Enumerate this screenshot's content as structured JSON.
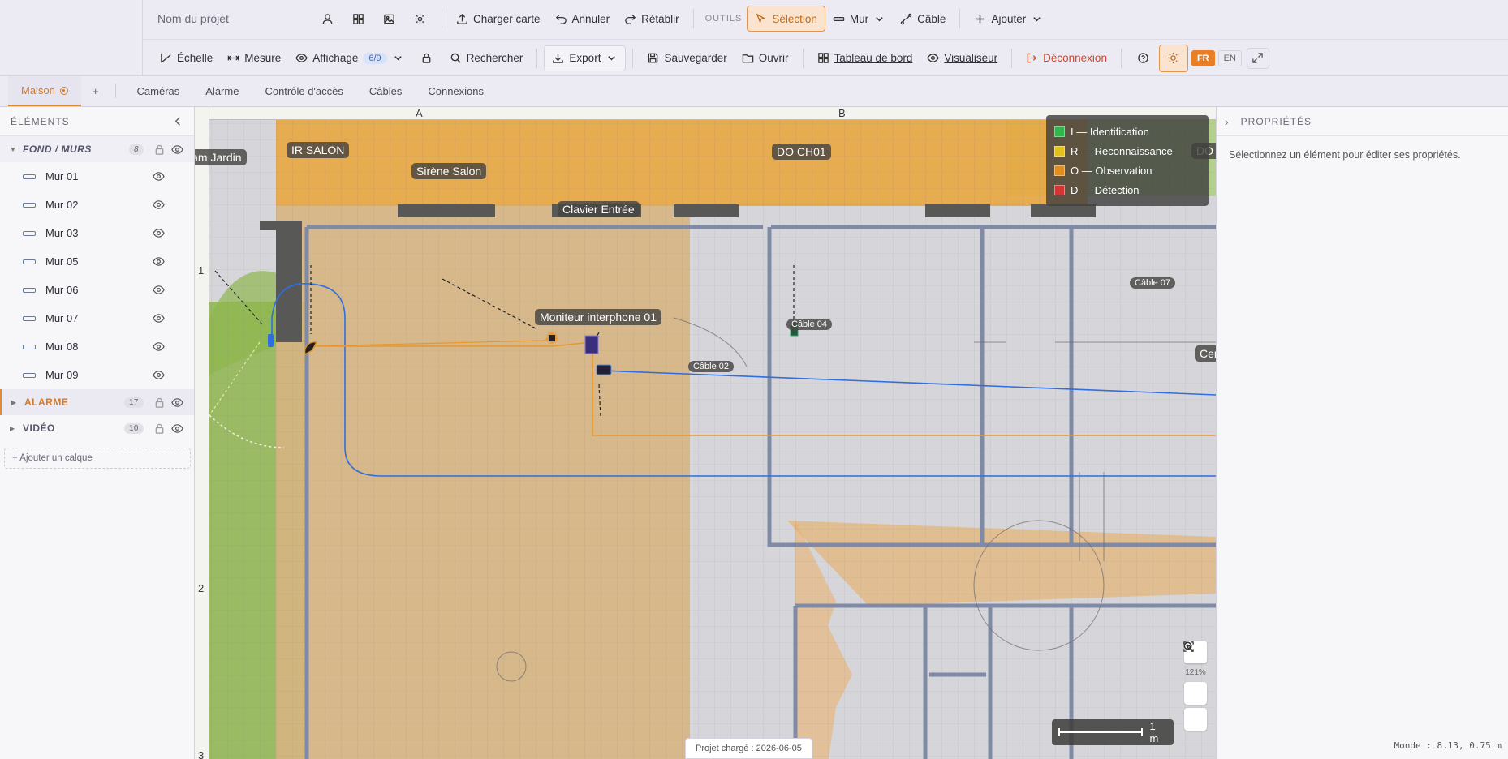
{
  "toolbar": {
    "project_placeholder": "Nom du projet",
    "load_map": "Charger carte",
    "undo": "Annuler",
    "redo": "Rétablir",
    "tools_label": "OUTILS",
    "selection": "Sélection",
    "wall": "Mur",
    "cable": "Câble",
    "add": "Ajouter",
    "scale": "Échelle",
    "measure": "Mesure",
    "display": "Affichage",
    "display_count": "6/9",
    "search": "Rechercher",
    "export": "Export",
    "save": "Sauvegarder",
    "open": "Ouvrir",
    "dashboard": "Tableau de bord",
    "viewer": "Visualiseur",
    "logout": "Déconnexion",
    "lang_fr": "FR",
    "lang_en": "EN"
  },
  "tabs": {
    "active": "Maison",
    "add": "+",
    "items": [
      "Caméras",
      "Alarme",
      "Contrôle d'accès",
      "Câbles",
      "Connexions"
    ]
  },
  "sidebar": {
    "title": "ÉLÉMENTS",
    "layers": {
      "fond": {
        "label": "FOND / MURS",
        "count": "8"
      },
      "alarme": {
        "label": "ALARME",
        "count": "17"
      },
      "video": {
        "label": "VIDÉO",
        "count": "10"
      }
    },
    "walls": [
      "Mur 01",
      "Mur 02",
      "Mur 03",
      "Mur 05",
      "Mur 06",
      "Mur 07",
      "Mur 08",
      "Mur 09"
    ],
    "add_layer": "+ Ajouter un calque"
  },
  "canvas": {
    "ruler_cols": [
      "A",
      "B"
    ],
    "ruler_rows": [
      "1",
      "2",
      "3"
    ],
    "device_labels": {
      "cam_jardin": "Cam Jardin",
      "ir_salon": "IR SALON",
      "sirene_salon": "Sirène Salon",
      "clavier_entree": "Clavier Entrée",
      "do_ch01": "DO CH01",
      "moniteur": "Moniteur interphone 01",
      "cen": "Cen",
      "do_edge": "DO C"
    },
    "cable_labels": {
      "c07": "Câble 07",
      "c04": "Câble 04",
      "c02": "Câble 02"
    },
    "legend": [
      {
        "label": "I — Identification",
        "color": "#2fb84e"
      },
      {
        "label": "R — Reconnaissance",
        "color": "#e2c21a"
      },
      {
        "label": "O — Observation",
        "color": "#e38c1f"
      },
      {
        "label": "D — Détection",
        "color": "#d63434"
      }
    ],
    "zoom_pct": "121%",
    "scale_label": "1 m",
    "status": "Projet chargé : 2026-06-05"
  },
  "right_panel": {
    "title": "PROPRIÉTÉS",
    "empty_text": "Sélectionnez un élément pour éditer ses propriétés."
  },
  "footer": {
    "world_coords": "Monde : 8.13, 0.75 m"
  },
  "colors": {
    "accent": "#e08a35",
    "cable_blue": "#2f6ee0",
    "cable_orange": "#e8962d"
  }
}
